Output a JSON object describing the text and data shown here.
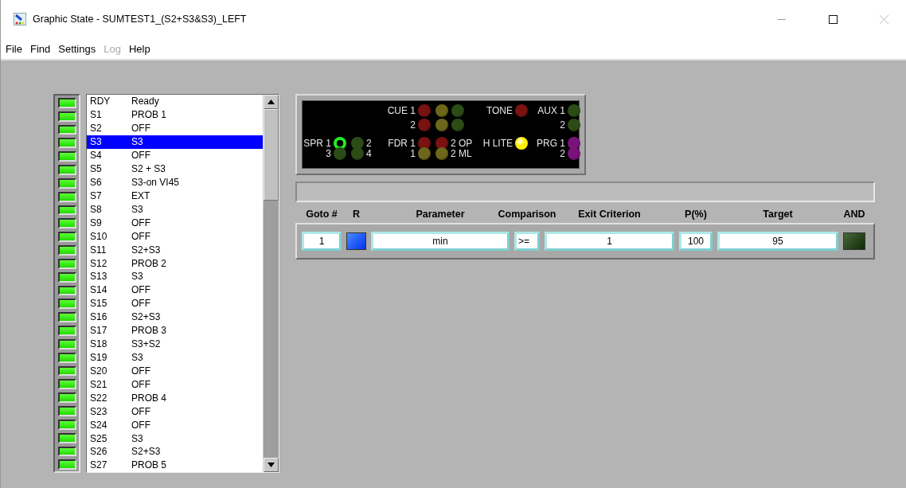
{
  "window": {
    "title": "Graphic State - SUMTEST1_(S2+S3&S3)_LEFT"
  },
  "menu": [
    {
      "label": "File",
      "disabled": false
    },
    {
      "label": "Find",
      "disabled": false
    },
    {
      "label": "Settings",
      "disabled": false
    },
    {
      "label": "Log",
      "disabled": true
    },
    {
      "label": "Help",
      "disabled": false
    }
  ],
  "states": [
    {
      "code": "RDY",
      "name": "Ready",
      "selected": false,
      "led_on": true
    },
    {
      "code": "S1",
      "name": "PROB 1",
      "selected": false,
      "led_on": true
    },
    {
      "code": "S2",
      "name": "OFF",
      "selected": false,
      "led_on": true
    },
    {
      "code": "S3",
      "name": "S3",
      "selected": true,
      "led_on": true
    },
    {
      "code": "S4",
      "name": "OFF",
      "selected": false,
      "led_on": true
    },
    {
      "code": "S5",
      "name": "S2 + S3",
      "selected": false,
      "led_on": true
    },
    {
      "code": "S6",
      "name": "S3-on VI45",
      "selected": false,
      "led_on": true
    },
    {
      "code": "S7",
      "name": "EXT",
      "selected": false,
      "led_on": true
    },
    {
      "code": "S8",
      "name": "S3",
      "selected": false,
      "led_on": true
    },
    {
      "code": "S9",
      "name": "OFF",
      "selected": false,
      "led_on": true
    },
    {
      "code": "S10",
      "name": "OFF",
      "selected": false,
      "led_on": true
    },
    {
      "code": "S11",
      "name": "S2+S3",
      "selected": false,
      "led_on": true
    },
    {
      "code": "S12",
      "name": "PROB 2",
      "selected": false,
      "led_on": true
    },
    {
      "code": "S13",
      "name": "S3",
      "selected": false,
      "led_on": true
    },
    {
      "code": "S14",
      "name": "OFF",
      "selected": false,
      "led_on": true
    },
    {
      "code": "S15",
      "name": "OFF",
      "selected": false,
      "led_on": true
    },
    {
      "code": "S16",
      "name": "S2+S3",
      "selected": false,
      "led_on": true
    },
    {
      "code": "S17",
      "name": "PROB 3",
      "selected": false,
      "led_on": true
    },
    {
      "code": "S18",
      "name": "S3+S2",
      "selected": false,
      "led_on": true
    },
    {
      "code": "S19",
      "name": "S3",
      "selected": false,
      "led_on": true
    },
    {
      "code": "S20",
      "name": "OFF",
      "selected": false,
      "led_on": true
    },
    {
      "code": "S21",
      "name": "OFF",
      "selected": false,
      "led_on": true
    },
    {
      "code": "S22",
      "name": "PROB 4",
      "selected": false,
      "led_on": true
    },
    {
      "code": "S23",
      "name": "OFF",
      "selected": false,
      "led_on": true
    },
    {
      "code": "S24",
      "name": "OFF",
      "selected": false,
      "led_on": true
    },
    {
      "code": "S25",
      "name": "S3",
      "selected": false,
      "led_on": true
    },
    {
      "code": "S26",
      "name": "S2+S3",
      "selected": false,
      "led_on": true
    },
    {
      "code": "S27",
      "name": "PROB 5",
      "selected": false,
      "led_on": true
    }
  ],
  "indicators": [
    [
      {
        "kind": "label",
        "text": "CUE 1"
      },
      {
        "kind": "lamp",
        "color": "#7a1212",
        "on": false
      },
      {
        "kind": "lamp",
        "color": "#6e661a",
        "on": false
      },
      {
        "kind": "lamp",
        "color": "#2c4c16",
        "on": false
      },
      {
        "kind": "label",
        "text": "TONE"
      },
      {
        "kind": "lamp",
        "color": "#7a1212",
        "on": false
      },
      {
        "kind": "label",
        "text": "AUX 1"
      },
      {
        "kind": "lamp",
        "color": "#2c4c16",
        "on": false
      }
    ],
    [
      {
        "kind": "label",
        "text": "2"
      },
      {
        "kind": "lamp",
        "color": "#7a1212",
        "on": false
      },
      {
        "kind": "lamp",
        "color": "#6e661a",
        "on": false
      },
      {
        "kind": "lamp",
        "color": "#2c4c16",
        "on": false
      },
      {
        "kind": "label",
        "text": "2"
      },
      {
        "kind": "lamp",
        "color": "#2c4c16",
        "on": false
      }
    ],
    [
      {
        "kind": "label",
        "text": "SPR 1"
      },
      {
        "kind": "ring",
        "color": "#22ee22",
        "on": true
      },
      {
        "kind": "lamp",
        "color": "#2c4c16",
        "on": false
      },
      {
        "kind": "label",
        "text": "2"
      },
      {
        "kind": "label",
        "text": "FDR 1"
      },
      {
        "kind": "lamp",
        "color": "#7a1212",
        "on": false
      },
      {
        "kind": "lamp",
        "color": "#7a1212",
        "on": false
      },
      {
        "kind": "label",
        "text": "2 OP"
      },
      {
        "kind": "label",
        "text": "H LITE"
      },
      {
        "kind": "lamp",
        "color": "#ffee00",
        "on": true
      },
      {
        "kind": "label",
        "text": "PRG 1"
      },
      {
        "kind": "lamp",
        "color": "#7a127a",
        "on": false
      }
    ],
    [
      {
        "kind": "label",
        "text": "3"
      },
      {
        "kind": "lamp",
        "color": "#2c4c16",
        "on": false
      },
      {
        "kind": "lamp",
        "color": "#2c4c16",
        "on": false
      },
      {
        "kind": "label",
        "text": "4"
      },
      {
        "kind": "label",
        "text": "1"
      },
      {
        "kind": "lamp",
        "color": "#6e661a",
        "on": false
      },
      {
        "kind": "lamp",
        "color": "#6e661a",
        "on": false
      },
      {
        "kind": "label",
        "text": "2 ML"
      },
      {
        "kind": "label",
        "text": "2"
      },
      {
        "kind": "lamp",
        "color": "#7a127a",
        "on": false
      }
    ]
  ],
  "criteria": {
    "columns": [
      "Goto #",
      "R",
      "Parameter",
      "Comparison",
      "Exit Criterion",
      "P(%)",
      "Target",
      "AND"
    ],
    "rows": [
      {
        "goto": "1",
        "r_on": true,
        "parameter": "min",
        "comparison": ">=",
        "exit_criterion": "1",
        "p": "100",
        "target": "95",
        "and_on": false
      }
    ]
  }
}
